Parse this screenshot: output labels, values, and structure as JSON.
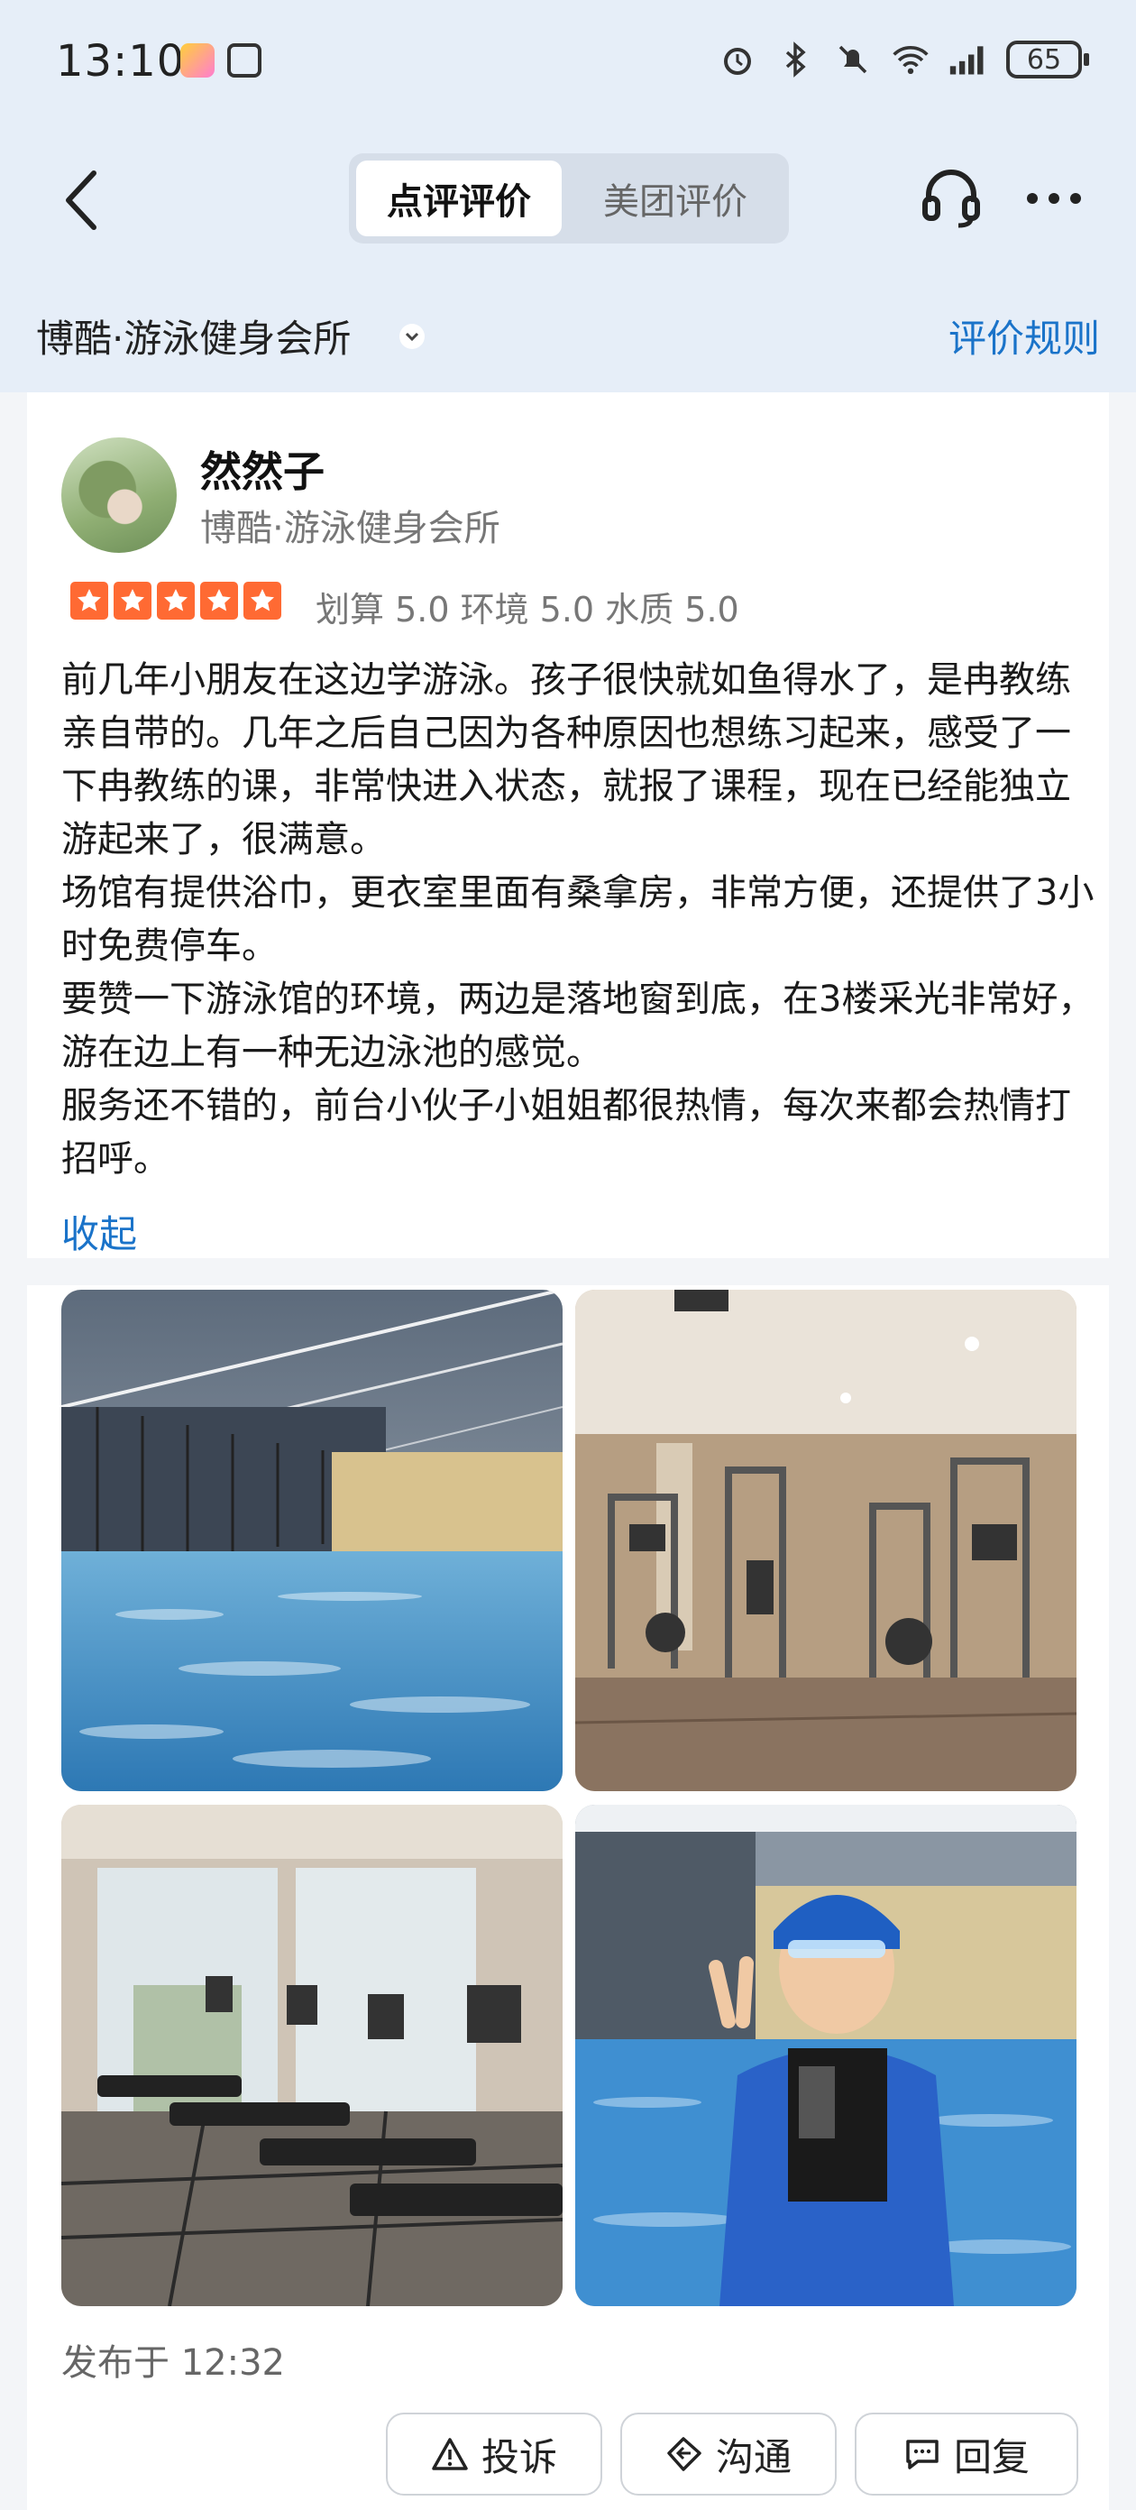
{
  "status_bar": {
    "time": "13:10",
    "battery": "65"
  },
  "nav": {
    "tabs": [
      {
        "label": "点评评价",
        "active": true
      },
      {
        "label": "美团评价",
        "active": false
      }
    ]
  },
  "shop": {
    "name": "博酷·游泳健身会所",
    "rules_link": "评价规则"
  },
  "review": {
    "user_name": "然然子",
    "user_shop": "博酷·游泳健身会所",
    "rating_stars": 5,
    "scores": "划算 5.0 环境 5.0 水质 5.0",
    "paragraphs": [
      "前几年小朋友在这边学游泳。孩子很快就如鱼得水了，是冉教练亲自带的。几年之后自己因为各种原因也想练习起来，感受了一下冉教练的课，非常快进入状态，就报了课程，现在已经能独立游起来了，很满意。",
      "场馆有提供浴巾，更衣室里面有桑拿房，非常方便，还提供了3小时免费停车。",
      "要赞一下游泳馆的环境，两边是落地窗到底，在3楼采光非常好，游在边上有一种无边泳池的感觉。",
      "服务还不错的，前台小伙子小姐姐都很热情，每次来都会热情打招呼。"
    ],
    "collapse_label": "收起",
    "publish_time": "发布于 12:32"
  },
  "actions": {
    "complain": "投诉",
    "chat": "沟通",
    "reply": "回复"
  },
  "colors": {
    "accent": "#1a73c9",
    "star": "#ff6a33"
  },
  "icons": [
    "back-arrow-icon",
    "headset-icon",
    "more-icon",
    "chevron-down-icon",
    "warning-icon",
    "chat-icon",
    "reply-icon"
  ]
}
